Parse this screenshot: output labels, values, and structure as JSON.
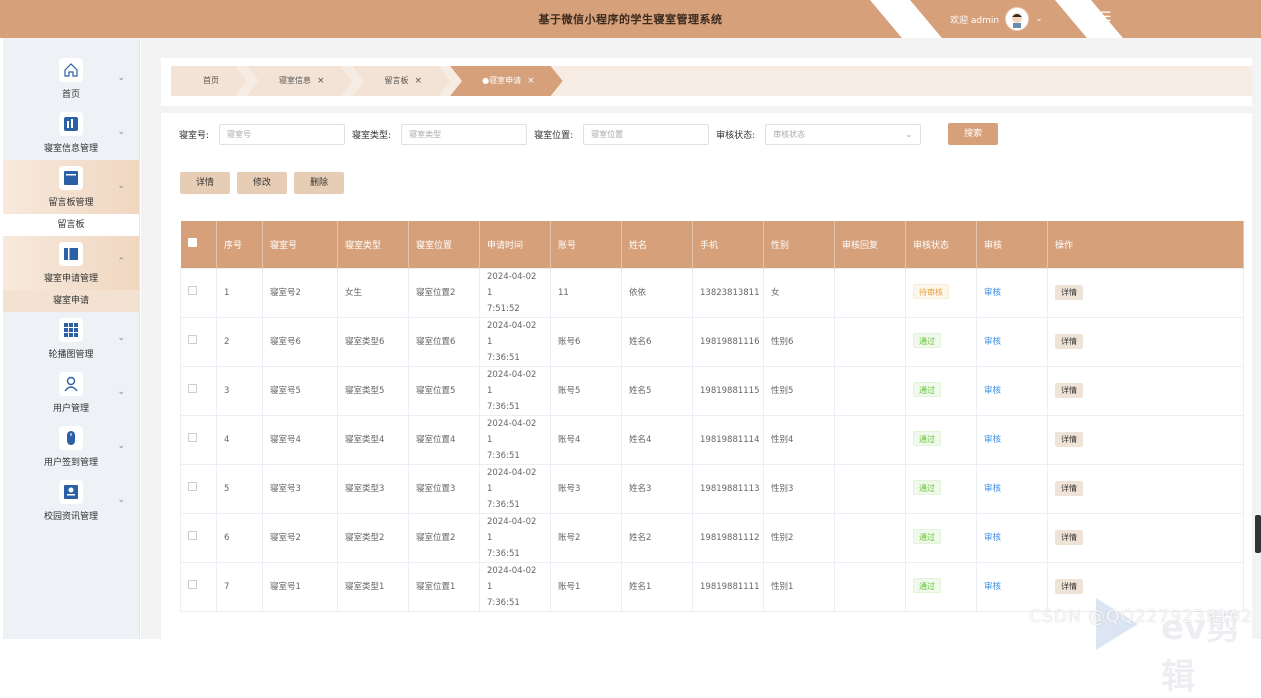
{
  "header": {
    "title": "基于微信小程序的学生寝室管理系统",
    "welcome": "欢迎 admin",
    "colors": {
      "brand": "#d6a07a"
    }
  },
  "sidebar": {
    "items": [
      {
        "label": "首页",
        "icon": "home-icon"
      },
      {
        "label": "寝室信息管理",
        "icon": "chart-bar-icon"
      },
      {
        "label": "留言板管理",
        "icon": "message-board-icon",
        "sub": "留言板"
      },
      {
        "label": "寝室申请管理",
        "icon": "book-icon",
        "sub": "寝室申请"
      },
      {
        "label": "轮播图管理",
        "icon": "grid-icon"
      },
      {
        "label": "用户管理",
        "icon": "user-icon"
      },
      {
        "label": "用户签到管理",
        "icon": "mouse-icon"
      },
      {
        "label": "校园资讯管理",
        "icon": "news-icon"
      }
    ]
  },
  "breadcrumbs": [
    {
      "label": "首页"
    },
    {
      "label": "寝室信息",
      "close": "×"
    },
    {
      "label": "留言板",
      "close": "×"
    },
    {
      "label": "●寝室申请",
      "close": "×",
      "active": true
    }
  ],
  "filters": {
    "room_no_label": "寝室号:",
    "room_no_placeholder": "寝室号",
    "room_type_label": "寝室类型:",
    "room_type_placeholder": "寝室类型",
    "room_loc_label": "寝室位置:",
    "room_loc_placeholder": "寝室位置",
    "status_label": "审核状态:",
    "status_placeholder": "审核状态",
    "search_label": "搜索"
  },
  "actions": {
    "detail": "详情",
    "edit": "修改",
    "delete": "删除"
  },
  "table": {
    "columns": [
      "序号",
      "寝室号",
      "寝室类型",
      "寝室位置",
      "申请时间",
      "账号",
      "姓名",
      "手机",
      "性别",
      "审核回复",
      "审核状态",
      "审核",
      "操作"
    ],
    "rows": [
      {
        "no": "1",
        "room": "寝室号2",
        "type": "女生",
        "loc": "寝室位置2",
        "date": "2024-04-02 1",
        "time": "7:51:52",
        "account": "11",
        "name": "依依",
        "phone": "13823813811",
        "gender": "女",
        "reply": "",
        "status": "待审核",
        "status_kind": "wait",
        "review": "审核",
        "op": "详情"
      },
      {
        "no": "2",
        "room": "寝室号6",
        "type": "寝室类型6",
        "loc": "寝室位置6",
        "date": "2024-04-02 1",
        "time": "7:36:51",
        "account": "账号6",
        "name": "姓名6",
        "phone": "19819881116",
        "gender": "性别6",
        "reply": "",
        "status": "通过",
        "status_kind": "pass",
        "review": "审核",
        "op": "详情"
      },
      {
        "no": "3",
        "room": "寝室号5",
        "type": "寝室类型5",
        "loc": "寝室位置5",
        "date": "2024-04-02 1",
        "time": "7:36:51",
        "account": "账号5",
        "name": "姓名5",
        "phone": "19819881115",
        "gender": "性别5",
        "reply": "",
        "status": "通过",
        "status_kind": "pass",
        "review": "审核",
        "op": "详情"
      },
      {
        "no": "4",
        "room": "寝室号4",
        "type": "寝室类型4",
        "loc": "寝室位置4",
        "date": "2024-04-02 1",
        "time": "7:36:51",
        "account": "账号4",
        "name": "姓名4",
        "phone": "19819881114",
        "gender": "性别4",
        "reply": "",
        "status": "通过",
        "status_kind": "pass",
        "review": "审核",
        "op": "详情"
      },
      {
        "no": "5",
        "room": "寝室号3",
        "type": "寝室类型3",
        "loc": "寝室位置3",
        "date": "2024-04-02 1",
        "time": "7:36:51",
        "account": "账号3",
        "name": "姓名3",
        "phone": "19819881113",
        "gender": "性别3",
        "reply": "",
        "status": "通过",
        "status_kind": "pass",
        "review": "审核",
        "op": "详情"
      },
      {
        "no": "6",
        "room": "寝室号2",
        "type": "寝室类型2",
        "loc": "寝室位置2",
        "date": "2024-04-02 1",
        "time": "7:36:51",
        "account": "账号2",
        "name": "姓名2",
        "phone": "19819881112",
        "gender": "性别2",
        "reply": "",
        "status": "通过",
        "status_kind": "pass",
        "review": "审核",
        "op": "详情"
      },
      {
        "no": "7",
        "room": "寝室号1",
        "type": "寝室类型1",
        "loc": "寝室位置1",
        "date": "2024-04-02 1",
        "time": "7:36:51",
        "account": "账号1",
        "name": "姓名1",
        "phone": "19819881111",
        "gender": "性别1",
        "reply": "",
        "status": "通过",
        "status_kind": "pass",
        "review": "审核",
        "op": "详情"
      }
    ]
  },
  "watermark": {
    "csdn": "CSDN @QQ2279239102",
    "ev": "ev剪辑"
  }
}
